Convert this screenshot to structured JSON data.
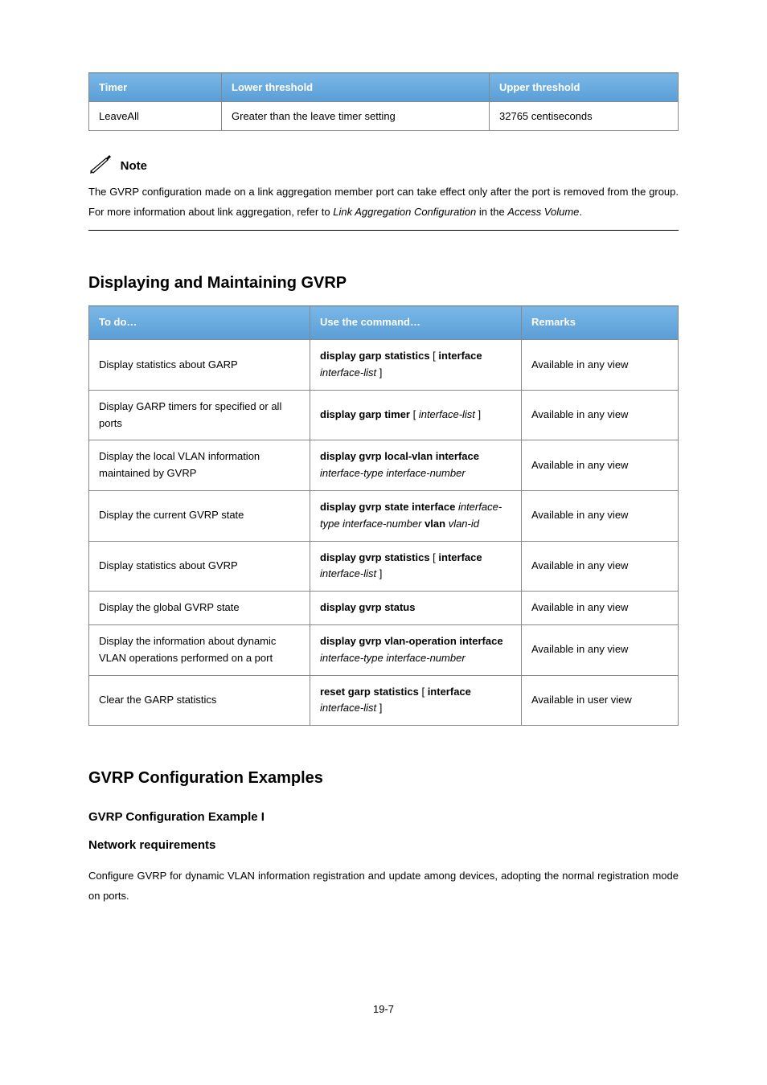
{
  "top_table": {
    "headers": [
      "Timer",
      "Lower threshold",
      "Upper threshold"
    ],
    "row": {
      "timer": "LeaveAll",
      "lower": "Greater than the leave timer setting",
      "upper": "32765 centiseconds"
    }
  },
  "note": {
    "label": "Note",
    "line1_a": "The GVRP configuration made on a link aggregation member port can take effect only after the port is",
    "line1_b": "removed from the group. For more information about link aggregation, refer to ",
    "line1_italic1": "Link Aggregation",
    "line2_italic1": "Configuration",
    "line2_mid": " in the ",
    "line2_italic2": "Access Volume",
    "line2_end": "."
  },
  "h2": "Displaying and Maintaining GVRP",
  "cmd_table": {
    "headers": [
      "To do…",
      "Use the command…",
      "Remarks"
    ],
    "rows": [
      {
        "todo": "Display statistics about GARP",
        "cmd_bold": "display garp statistics",
        "cmd_punc_open": " [ ",
        "cmd_bold2": "interface",
        "cmd_arg": " interface-list",
        "cmd_punc_close": " ]",
        "remarks": "Available in any view"
      },
      {
        "todo": "Display GARP timers for specified or all ports",
        "cmd_bold": "display garp timer",
        "cmd_punc_open": " [ ",
        "cmd_arg": "interface-list",
        "cmd_punc_close": " ]",
        "remarks": "Available in any view"
      },
      {
        "todo": "Display the local VLAN information maintained by GVRP",
        "cmd_bold": "display gvrp local-vlan interface",
        "cmd_arg": " interface-type interface-number",
        "remarks": "Available in any view"
      },
      {
        "todo": "Display the current GVRP state",
        "cmd_bold": "display gvrp state interface",
        "cmd_arg": " interface-type interface-number",
        "cmd_bold2": " vlan",
        "cmd_arg2": " vlan-id",
        "remarks": "Available in any view"
      },
      {
        "todo": "Display statistics about GVRP",
        "cmd_bold": "display gvrp statistics",
        "cmd_punc_open": " [ ",
        "cmd_bold2": "interface",
        "cmd_arg": " interface-list",
        "cmd_punc_close": " ]",
        "remarks": "Available in any view"
      },
      {
        "todo": "Display the global GVRP state",
        "cmd_bold": "display gvrp status",
        "remarks": "Available in any view"
      },
      {
        "todo": "Display the information about dynamic VLAN operations performed on a port",
        "cmd_bold": "display gvrp vlan-operation interface",
        "cmd_arg": " interface-type interface-number",
        "remarks": "Available in any view"
      },
      {
        "todo": "Clear the GARP statistics",
        "cmd_bold": "reset garp statistics",
        "cmd_punc_open": " [ ",
        "cmd_bold2": "interface",
        "cmd_arg": " interface-list",
        "cmd_punc_close": " ]",
        "remarks": "Available in user view"
      }
    ]
  },
  "h2b": "GVRP Configuration Examples",
  "h3a": "GVRP Configuration Example I",
  "h3b": "Network requirements",
  "body": "Configure GVRP for dynamic VLAN information registration and update among devices, adopting the normal registration mode on ports.",
  "page_num": "19-7"
}
